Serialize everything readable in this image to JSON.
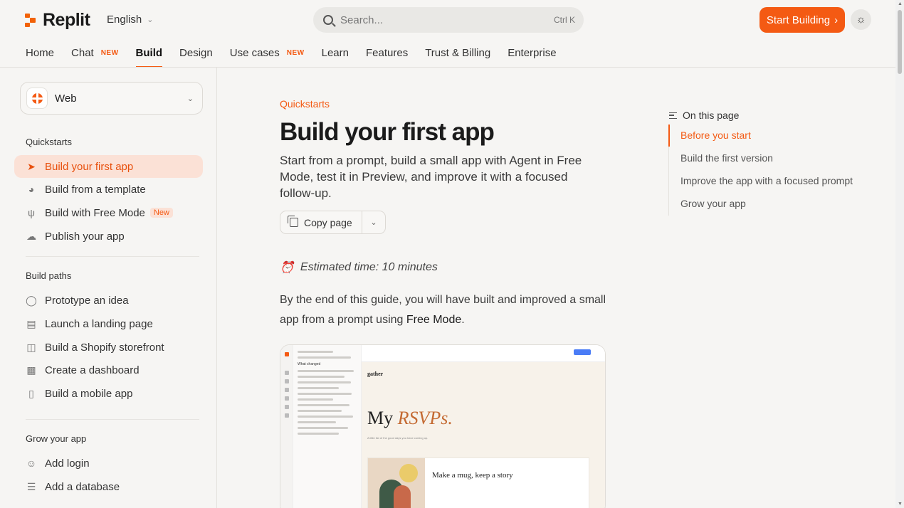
{
  "header": {
    "logo_text": "Replit",
    "language": "English",
    "search_placeholder": "Search...",
    "search_shortcut": "Ctrl K",
    "start_button": "Start Building",
    "start_button_icon": "chevron-right-icon",
    "theme_icon": "sun-icon"
  },
  "nav": {
    "tabs": [
      {
        "label": "Home",
        "badge": ""
      },
      {
        "label": "Chat",
        "badge": "NEW"
      },
      {
        "label": "Build",
        "badge": ""
      },
      {
        "label": "Design",
        "badge": ""
      },
      {
        "label": "Use cases",
        "badge": "NEW"
      },
      {
        "label": "Learn",
        "badge": ""
      },
      {
        "label": "Features",
        "badge": ""
      },
      {
        "label": "Trust & Billing",
        "badge": ""
      },
      {
        "label": "Enterprise",
        "badge": ""
      }
    ],
    "active": "Build"
  },
  "sidebar": {
    "platform": "Web",
    "sections": [
      {
        "title": "Quickstarts",
        "items": [
          {
            "label": "Build your first app",
            "icon": "rocket-icon",
            "active": true
          },
          {
            "label": "Build from a template",
            "icon": "palette-icon"
          },
          {
            "label": "Build with Free Mode",
            "icon": "sprout-icon",
            "badge": "New"
          },
          {
            "label": "Publish your app",
            "icon": "cloud-upload-icon"
          }
        ]
      },
      {
        "title": "Build paths",
        "items": [
          {
            "label": "Prototype an idea",
            "icon": "lightbulb-icon"
          },
          {
            "label": "Launch a landing page",
            "icon": "layout-icon"
          },
          {
            "label": "Build a Shopify storefront",
            "icon": "shopping-bag-icon"
          },
          {
            "label": "Create a dashboard",
            "icon": "bar-chart-icon"
          },
          {
            "label": "Build a mobile app",
            "icon": "phone-icon"
          }
        ]
      },
      {
        "title": "Grow your app",
        "items": [
          {
            "label": "Add login",
            "icon": "user-lock-icon"
          },
          {
            "label": "Add a database",
            "icon": "database-icon"
          }
        ]
      }
    ]
  },
  "main": {
    "breadcrumb": "Quickstarts",
    "title": "Build your first app",
    "lead": "Start from a prompt, build a small app with Agent in Free Mode, test it in Preview, and improve it with a focused follow-up.",
    "copy_button": "Copy page",
    "estimated": "Estimated time: 10 minutes",
    "intro_before": "By the end of this guide, you will have built and improved a small app from a prompt using ",
    "intro_code": "Free Mode",
    "intro_after": "."
  },
  "screenshot": {
    "app_name": "gather",
    "heading_plain": "My ",
    "heading_accent": "RSVPs.",
    "subtitle": "A little list of the good days you have coming up.",
    "card_title": "Make a mug, keep a story",
    "chat_heading": "What changed"
  },
  "toc": {
    "heading": "On this page",
    "items": [
      "Before you start",
      "Build the first version",
      "Improve the app with a focused prompt",
      "Grow your app"
    ],
    "active": "Before you start"
  },
  "colors": {
    "accent": "#f45a13",
    "background": "#f6f5f3",
    "active_bg": "#fbe1d6"
  }
}
